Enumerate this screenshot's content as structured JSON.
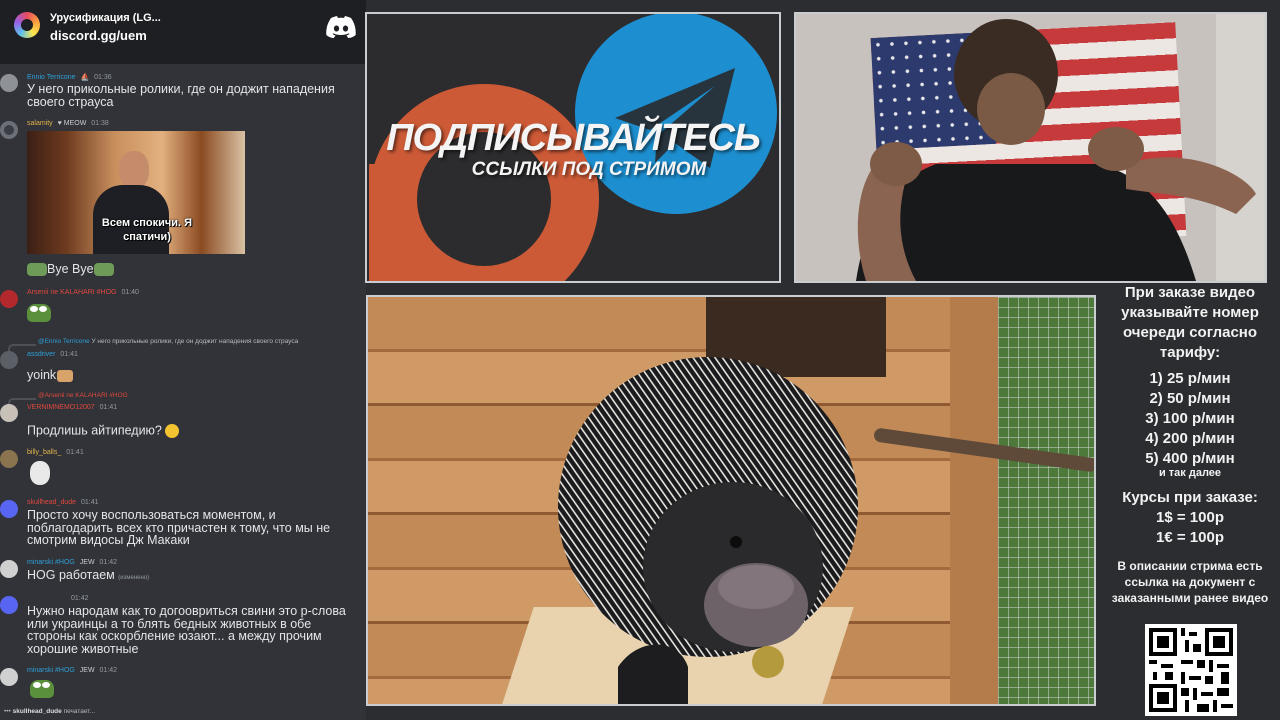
{
  "discord": {
    "server_name": "Урусификация (LG...",
    "invite": "discord.gg/uem",
    "messages": [
      {
        "nick": "Ennio Terricone",
        "time": "01:36",
        "text": "У него прикольные ролики, где он доджит нападения своего страуса",
        "nick_color": "#2f9fd7"
      },
      {
        "nick": "salamity",
        "badge": "MEOW",
        "time": "01:38",
        "gif_caption": "Всем спокичи. Я спатичи)",
        "text": "Bye Bye",
        "nick_color": "#e3b44b"
      },
      {
        "nick": "Arsenii ne KALAHARI #HOG",
        "time": "01:40",
        "nick_color": "#e1483f"
      },
      {
        "reply_to": "@Ennio Terricone",
        "reply_text": "У него прикольные ролики, где он доджит нападения своего страуса",
        "nick": "assdriver",
        "time": "01:41",
        "text": "yoink",
        "nick_color": "#2f9fd7"
      },
      {
        "reply_to": "@Arsenii ne KALAHARI #HOG",
        "nick": "VERNIMNEMO12007",
        "time": "01:41",
        "text": "Продлишь айтипедию?",
        "nick_color": "#e1483f"
      },
      {
        "nick": "billy_balls_",
        "time": "01:41",
        "nick_color": "#e3b44b"
      },
      {
        "nick": "skullhead_dude",
        "time": "01:41",
        "text": "Просто хочу воспользоваться моментом, и поблагодарить всех кто причастен к тому, что мы не смотрим видосы Дж Макаки",
        "nick_color": "#e1483f"
      },
      {
        "nick": "minarski #HOG",
        "badge": "JEW",
        "time": "01:42",
        "text": "HOG работаем",
        "edited": "(изменено)",
        "nick_color": "#2f9fd7"
      },
      {
        "time": "01:42",
        "text": "Нужно народам как то догоовриться свини это р-слова или украинцы а то блять бедных животных в обе стороны как оскорбление юзают... а между прочим хорошие животные"
      },
      {
        "nick": "minarski #HOG",
        "badge": "JEW",
        "time": "01:42",
        "nick_color": "#2f9fd7"
      }
    ],
    "typing": {
      "user": "skullhead_dude",
      "suffix": "печатает..."
    }
  },
  "promo": {
    "title": "ПОДПИСЫВАЙТЕСЬ",
    "subtitle": "ССЫЛКИ ПОД СТРИМОМ"
  },
  "info": {
    "header": "При заказе видео указывайте номер очереди согласно тарифу:",
    "tariffs": [
      "1) 25 р/мин",
      "2) 50 р/мин",
      "3) 100 р/мин",
      "4) 200 р/мин",
      "5) 400 р/мин"
    ],
    "tariffs_more": "и так далее",
    "rates_title": "Курсы при заказе:",
    "rates": [
      "1$ = 100р",
      "1€ = 100р"
    ],
    "doc_note": "В описании стрима есть ссылка на документ с заказанными ранее видео"
  },
  "colors": {
    "chat_bg": "#313338",
    "header_bg": "#1e1f22",
    "accent_blue": "#1d8fd0",
    "accent_orange": "#cc5a37"
  }
}
